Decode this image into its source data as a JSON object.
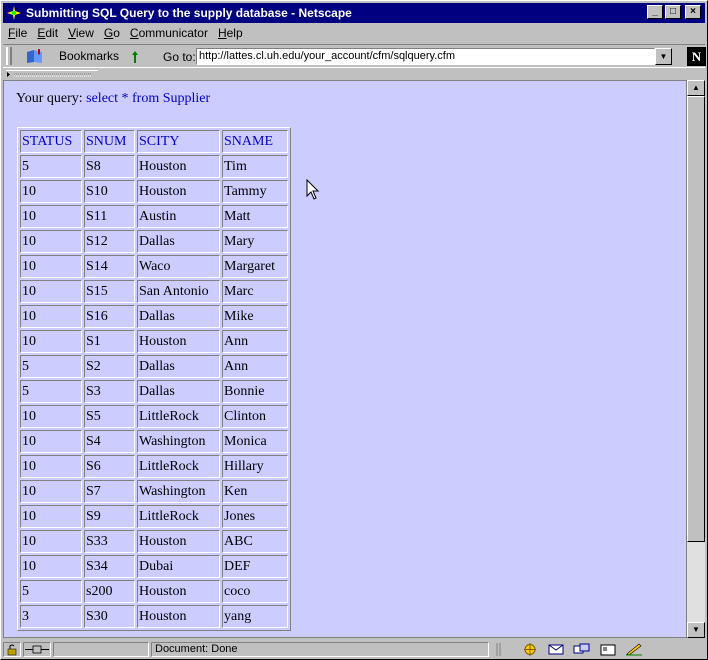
{
  "window": {
    "title": "Submitting SQL Query to the supply database - Netscape",
    "buttons": [
      "_",
      "□",
      "×"
    ]
  },
  "menu": {
    "items": [
      {
        "first": "F",
        "rest": "ile"
      },
      {
        "first": "E",
        "rest": "dit"
      },
      {
        "first": "V",
        "rest": "iew"
      },
      {
        "first": "G",
        "rest": "o"
      },
      {
        "first": "C",
        "rest": "ommunicator"
      },
      {
        "first": "H",
        "rest": "elp"
      }
    ]
  },
  "location": {
    "bookmarks_label": "Bookmarks",
    "goto_label": "Go to:",
    "url": "http://lattes.cl.uh.edu/your_account/cfm/sqlquery.cfm"
  },
  "page": {
    "query_label": "Your query:",
    "query_text": "select * from Supplier",
    "table": {
      "headers": [
        "STATUS",
        "SNUM",
        "SCITY",
        "SNAME"
      ],
      "rows": [
        [
          "5",
          "S8",
          "Houston",
          "Tim"
        ],
        [
          "10",
          "S10",
          "Houston",
          "Tammy"
        ],
        [
          "10",
          "S11",
          "Austin",
          "Matt"
        ],
        [
          "10",
          "S12",
          "Dallas",
          "Mary"
        ],
        [
          "10",
          "S14",
          "Waco",
          "Margaret"
        ],
        [
          "10",
          "S15",
          "San Antonio",
          "Marc"
        ],
        [
          "10",
          "S16",
          "Dallas",
          "Mike"
        ],
        [
          "10",
          "S1",
          "Houston",
          "Ann"
        ],
        [
          "5",
          "S2",
          "Dallas",
          "Ann"
        ],
        [
          "5",
          "S3",
          "Dallas",
          "Bonnie"
        ],
        [
          "10",
          "S5",
          "LittleRock",
          "Clinton"
        ],
        [
          "10",
          "S4",
          "Washington",
          "Monica"
        ],
        [
          "10",
          "S6",
          "LittleRock",
          "Hillary"
        ],
        [
          "10",
          "S7",
          "Washington",
          "Ken"
        ],
        [
          "10",
          "S9",
          "LittleRock",
          "Jones"
        ],
        [
          "10",
          "S33",
          "Houston",
          "ABC"
        ],
        [
          "10",
          "S34",
          "Dubai",
          "DEF"
        ],
        [
          "5",
          "s200",
          "Houston",
          "coco"
        ],
        [
          "3",
          "S30",
          "Houston",
          "yang"
        ]
      ]
    }
  },
  "status": {
    "text": "Document: Done"
  },
  "colors": {
    "titlebar": "#000080",
    "page_background": "#ccccff",
    "link_text": "#0000cc"
  }
}
